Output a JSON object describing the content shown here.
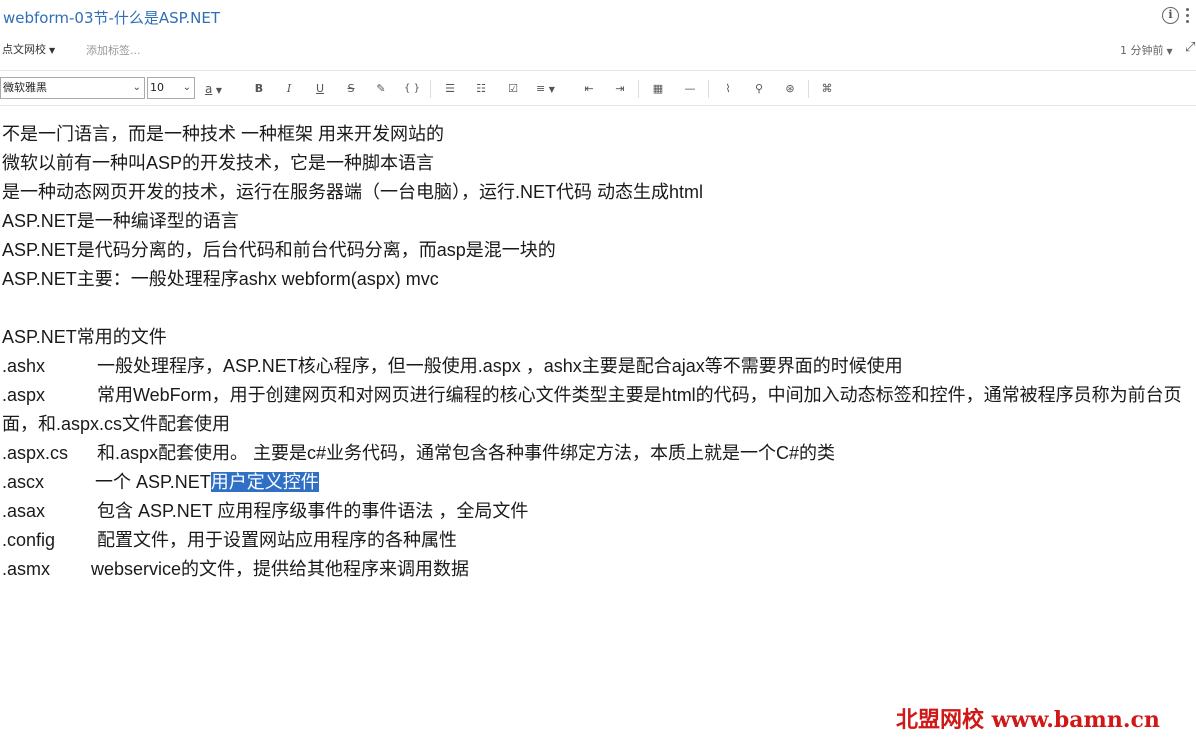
{
  "window": {
    "title": "webform-03节-什么是ASP.NET"
  },
  "meta": {
    "notebook": "点文网校",
    "add_tag": "添加标签...",
    "modified": "1 分钟前"
  },
  "toolbar": {
    "font_family": "微软雅黑",
    "font_size": "10",
    "font_color_glyph": "a",
    "buttons": [
      "B",
      "I",
      "U",
      "S"
    ]
  },
  "note": {
    "lines": [
      "不是一门语言，而是一种技术 一种框架 用来开发网站的",
      "微软以前有一种叫ASP的开发技术，它是一种脚本语言",
      "是一种动态网页开发的技术，运行在服务器端（一台电脑），运行.NET代码 动态生成html",
      "ASP.NET是一种编译型的语言",
      "ASP.NET是代码分离的，后台代码和前台代码分离，而asp是混一块的",
      "ASP.NET主要：一般处理程序ashx webform(aspx) mvc"
    ],
    "files_heading": "ASP.NET常用的文件",
    "files": [
      {
        "ext": ".ashx",
        "desc": "一般处理程序，ASP.NET核心程序，但一般使用.aspx ，ashx主要是配合ajax等不需要界面的时候使用"
      },
      {
        "ext": ".aspx",
        "desc": "常用WebForm，用于创建网页和对网页进行编程的核心文件类型主要是html的代码，中间加入动态标签和控件，通常被程序员称为前台页面，和.aspx.cs文件配套使用"
      },
      {
        "ext": ".aspx.cs",
        "desc": "和.aspx配套使用。 主要是c#业务代码，通常包含各种事件绑定方法，本质上就是一个C#的类"
      },
      {
        "ext": ".ascx",
        "desc_before": "一个 ASP.NET",
        "desc_selected": "用户定义控件"
      },
      {
        "ext": ".asax",
        "desc": "包含 ASP.NET 应用程序级事件的事件语法 ，全局文件"
      },
      {
        "ext": ".config",
        "desc": "配置文件，用于设置网站应用程序的各种属性"
      },
      {
        "ext": ".asmx",
        "desc": "webservice的文件，提供给其他程序来调用数据"
      }
    ]
  },
  "watermark": "北盟网校 www.bamn.cn"
}
